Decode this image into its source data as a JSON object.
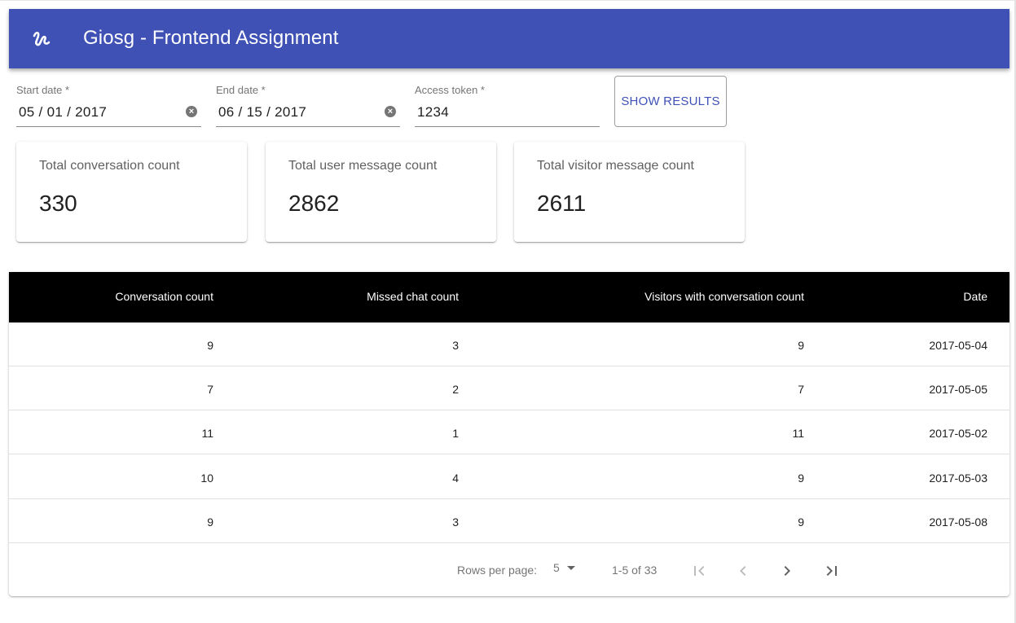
{
  "app": {
    "title": "Giosg - Frontend Assignment",
    "logo_icon": "giosg-logo-icon"
  },
  "filters": {
    "start_date": {
      "label": "Start date *",
      "value": "05 / 01 / 2017"
    },
    "end_date": {
      "label": "End date *",
      "value": "06 / 15 / 2017"
    },
    "access_token": {
      "label": "Access token *",
      "value": "1234"
    },
    "show_results_label": "SHOW RESULTS"
  },
  "summary": [
    {
      "label": "Total conversation count",
      "value": "330"
    },
    {
      "label": "Total user message count",
      "value": "2862"
    },
    {
      "label": "Total visitor message count",
      "value": "2611"
    }
  ],
  "table": {
    "headers": [
      "Conversation count",
      "Missed chat count",
      "Visitors with conversation count",
      "Date"
    ],
    "rows": [
      [
        "9",
        "3",
        "9",
        "2017-05-04"
      ],
      [
        "7",
        "2",
        "7",
        "2017-05-05"
      ],
      [
        "11",
        "1",
        "11",
        "2017-05-02"
      ],
      [
        "10",
        "4",
        "9",
        "2017-05-03"
      ],
      [
        "9",
        "3",
        "9",
        "2017-05-08"
      ]
    ]
  },
  "pagination": {
    "rows_per_page_label": "Rows per page:",
    "rows_per_page_value": "5",
    "range_text": "1-5 of 33"
  },
  "colors": {
    "appbar": "#3f51b5",
    "accent": "#3f51b5",
    "table_header": "#000000"
  }
}
